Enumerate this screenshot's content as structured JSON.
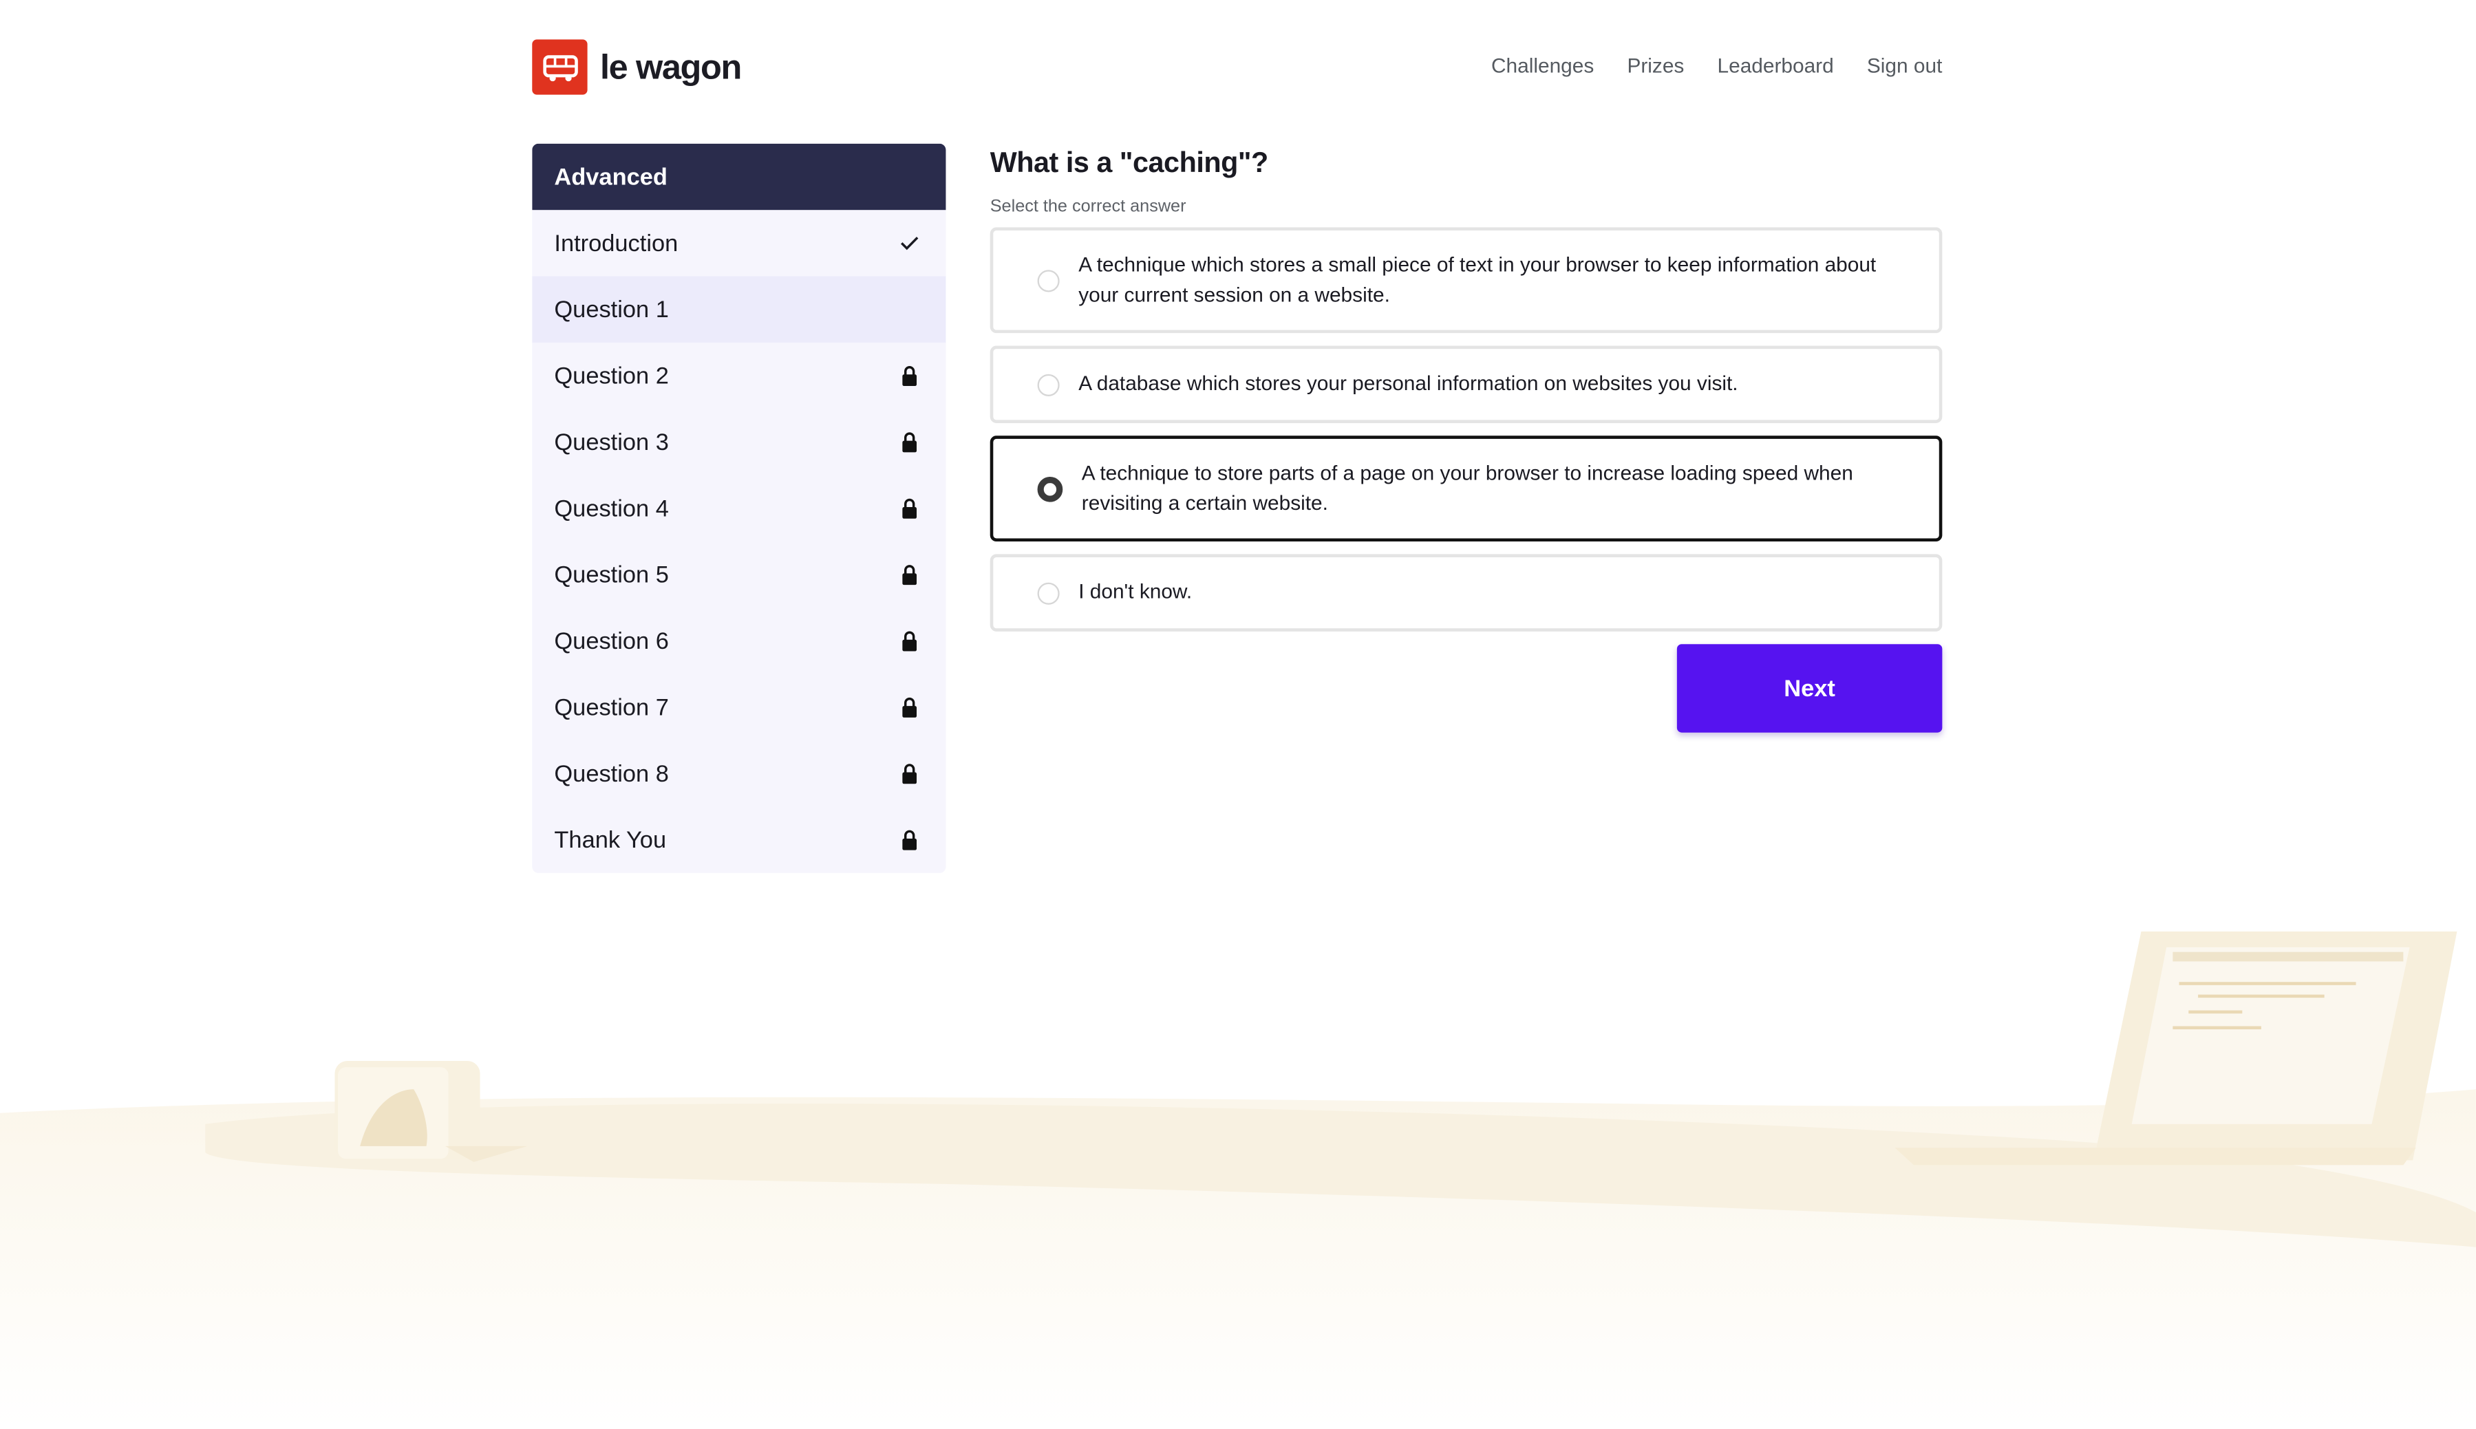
{
  "app": {
    "logo_text": "le wagon",
    "brand_color": "#e0331f"
  },
  "nav": {
    "items": [
      "Challenges",
      "Prizes",
      "Leaderboard",
      "Sign out"
    ]
  },
  "sidebar": {
    "header": "Advanced",
    "items": [
      {
        "label": "Introduction",
        "icon": "check-icon",
        "active": false
      },
      {
        "label": "Question 1",
        "icon": "",
        "active": true
      },
      {
        "label": "Question 2",
        "icon": "lock-icon",
        "active": false
      },
      {
        "label": "Question 3",
        "icon": "lock-icon",
        "active": false
      },
      {
        "label": "Question 4",
        "icon": "lock-icon",
        "active": false
      },
      {
        "label": "Question 5",
        "icon": "lock-icon",
        "active": false
      },
      {
        "label": "Question 6",
        "icon": "lock-icon",
        "active": false
      },
      {
        "label": "Question 7",
        "icon": "lock-icon",
        "active": false
      },
      {
        "label": "Question 8",
        "icon": "lock-icon",
        "active": false
      },
      {
        "label": "Thank You",
        "icon": "lock-icon",
        "active": false
      }
    ]
  },
  "question": {
    "title": "What is a \"caching\"?",
    "subtitle": "Select the correct answer",
    "answers": [
      {
        "text": "A technique which stores a small piece of text in your browser to keep information about your current session on a website.",
        "selected": false
      },
      {
        "text": "A database which stores your personal information on websites you visit.",
        "selected": false
      },
      {
        "text": "A technique to store parts of a page on your browser to increase loading speed when revisiting a certain website.",
        "selected": true
      },
      {
        "text": "I don't know.",
        "selected": false
      }
    ],
    "next_label": "Next"
  },
  "colors": {
    "sidebar_header": "#2a2c4c",
    "sidebar_bg": "#f6f5fd",
    "sidebar_active": "#ecebfb",
    "primary_button": "#5613f0"
  }
}
